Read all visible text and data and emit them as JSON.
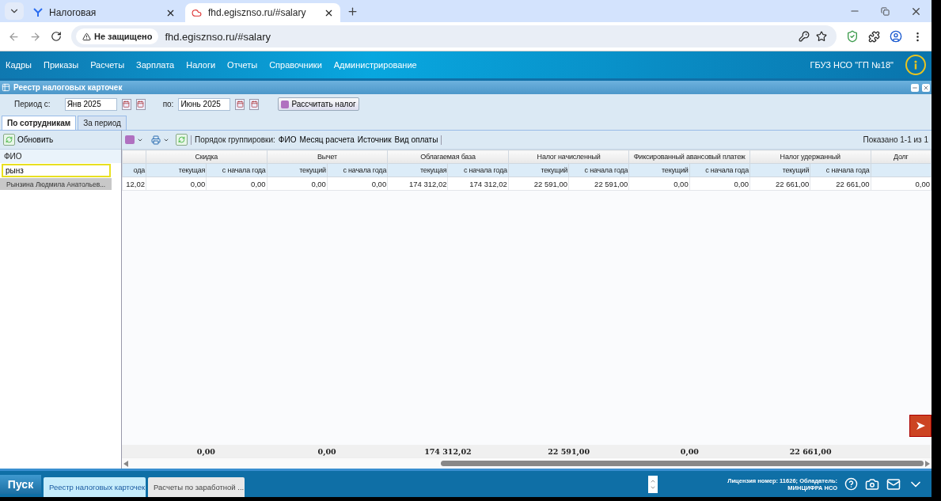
{
  "browser": {
    "tabs": [
      {
        "title": "Налоговая",
        "selected": false
      },
      {
        "title": "fhd.egisznso.ru/#salary",
        "selected": true
      }
    ],
    "security": "Не защищено",
    "url": "fhd.egisznso.ru/#salary"
  },
  "menu": [
    "Кадры",
    "Приказы",
    "Расчеты",
    "Зарплата",
    "Налоги",
    "Отчеты",
    "Справочники",
    "Администрирование"
  ],
  "organization": "ГБУЗ НСО \"ГП №18\"",
  "window": {
    "title": "Реестр налоговых карточек"
  },
  "period": {
    "from_label": "Период с:",
    "from": "Янв 2025",
    "to_label": "по:",
    "to": "Июнь 2025",
    "calculate": "Рассчитать налог"
  },
  "tabs": [
    {
      "label": "По сотрудникам",
      "selected": true
    },
    {
      "label": "За период",
      "selected": false
    }
  ],
  "left_panel": {
    "refresh": "Обновить",
    "column": "ФИО",
    "filter": "рынз",
    "items": [
      {
        "name": "Рынзина Людмила Анатольев...",
        "selected": true
      }
    ]
  },
  "grid_toolbar": {
    "grouping_label": "Порядок группировки:",
    "grouping": [
      "ФИО",
      "Месяц расчета",
      "Источник",
      "Вид оплаты"
    ],
    "shown": "Показано 1-1 из 1"
  },
  "grid": {
    "lead_column": "ода",
    "groups": [
      {
        "title": "Скидка",
        "columns": [
          "текущая",
          "с начала года"
        ],
        "total": "0,00"
      },
      {
        "title": "Вычет",
        "columns": [
          "текущий",
          "с начала года"
        ],
        "total": "0,00"
      },
      {
        "title": "Облагаемая база",
        "columns": [
          "текущая",
          "с начала года"
        ],
        "total": "174 312,02"
      },
      {
        "title": "Налог начисленный",
        "columns": [
          "текущий",
          "с начала года"
        ],
        "total": "22 591,00"
      },
      {
        "title": "Фиксированный авансовый платеж",
        "columns": [
          "текущий",
          "с начала года"
        ],
        "total": "0,00"
      },
      {
        "title": "Налог удержанный",
        "columns": [
          "текущий",
          "с начала года"
        ],
        "total": "22 661,00"
      },
      {
        "title": "Долг"
      }
    ],
    "rows": [
      [
        "12,02",
        "0,00",
        "0,00",
        "0,00",
        "0,00",
        "174 312,02",
        "174 312,02",
        "22 591,00",
        "22 591,00",
        "0,00",
        "0,00",
        "22 661,00",
        "22 661,00",
        "0,00"
      ]
    ]
  },
  "taskbar": {
    "start": "Пуск",
    "items": [
      {
        "label": "Реестр налоговых карточек",
        "selected": true
      },
      {
        "label": "Расчеты по заработной ...",
        "selected": false
      }
    ],
    "license": "Лицензия номер: 11626; Обладатель:",
    "owner": "МИНЦИФРА НСО"
  }
}
